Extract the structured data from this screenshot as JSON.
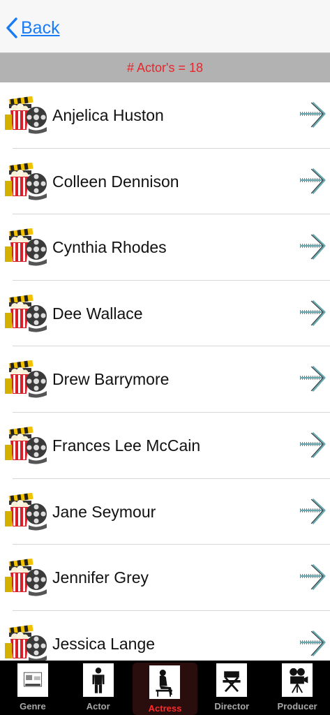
{
  "navbar": {
    "back_label": "Back"
  },
  "header": {
    "count_text": "# Actor's = 18"
  },
  "actresses": [
    "Anjelica Huston",
    "Colleen Dennison",
    "Cynthia Rhodes",
    "Dee Wallace",
    "Drew Barrymore",
    "Frances Lee McCain",
    "Jane Seymour",
    "Jennifer Grey",
    "Jessica Lange"
  ],
  "tabs": [
    {
      "label": "Genre",
      "icon": "genre-icon"
    },
    {
      "label": "Actor",
      "icon": "actor-icon"
    },
    {
      "label": "Actress",
      "icon": "actress-icon"
    },
    {
      "label": "Director",
      "icon": "director-chair-icon"
    },
    {
      "label": "Producer",
      "icon": "movie-camera-icon"
    }
  ],
  "selected_tab": "Actress",
  "colors": {
    "accent": "#1a7cf5",
    "count_text": "#e8262c",
    "selected_tab": "#ff2b2b"
  }
}
